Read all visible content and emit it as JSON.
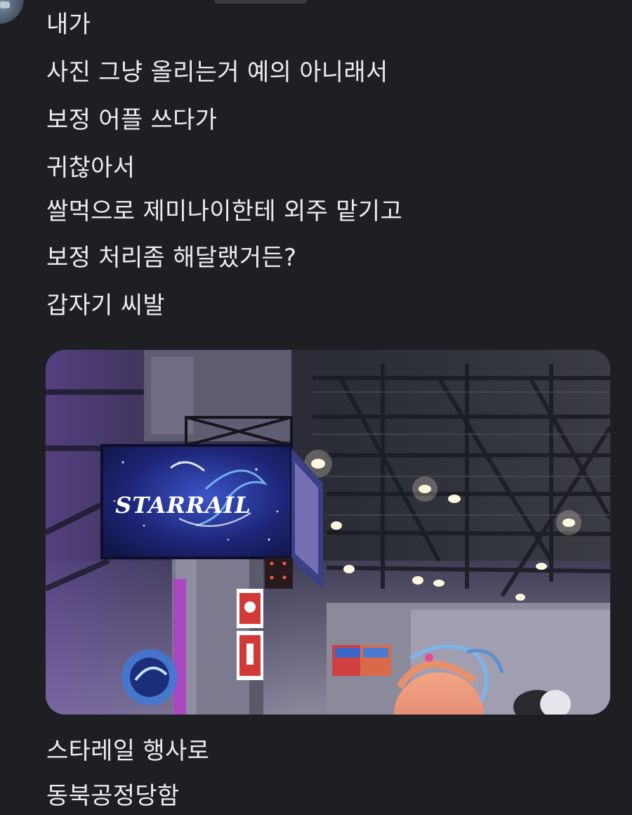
{
  "post": {
    "lines_top": [
      "내가",
      "사진 그냥 올리는거 예의 아니래서",
      "보정 어플 쓰다가",
      "귀찮아서",
      "쌀먹으로 제미나이한테 외주 맡기고",
      "보정 처리좀 해달랬거든?",
      "갑자기 씨발"
    ],
    "lines_bottom": [
      "스타레일 행사로",
      "동북공정당함"
    ]
  },
  "photo": {
    "sign_text": "STARRAIL"
  }
}
